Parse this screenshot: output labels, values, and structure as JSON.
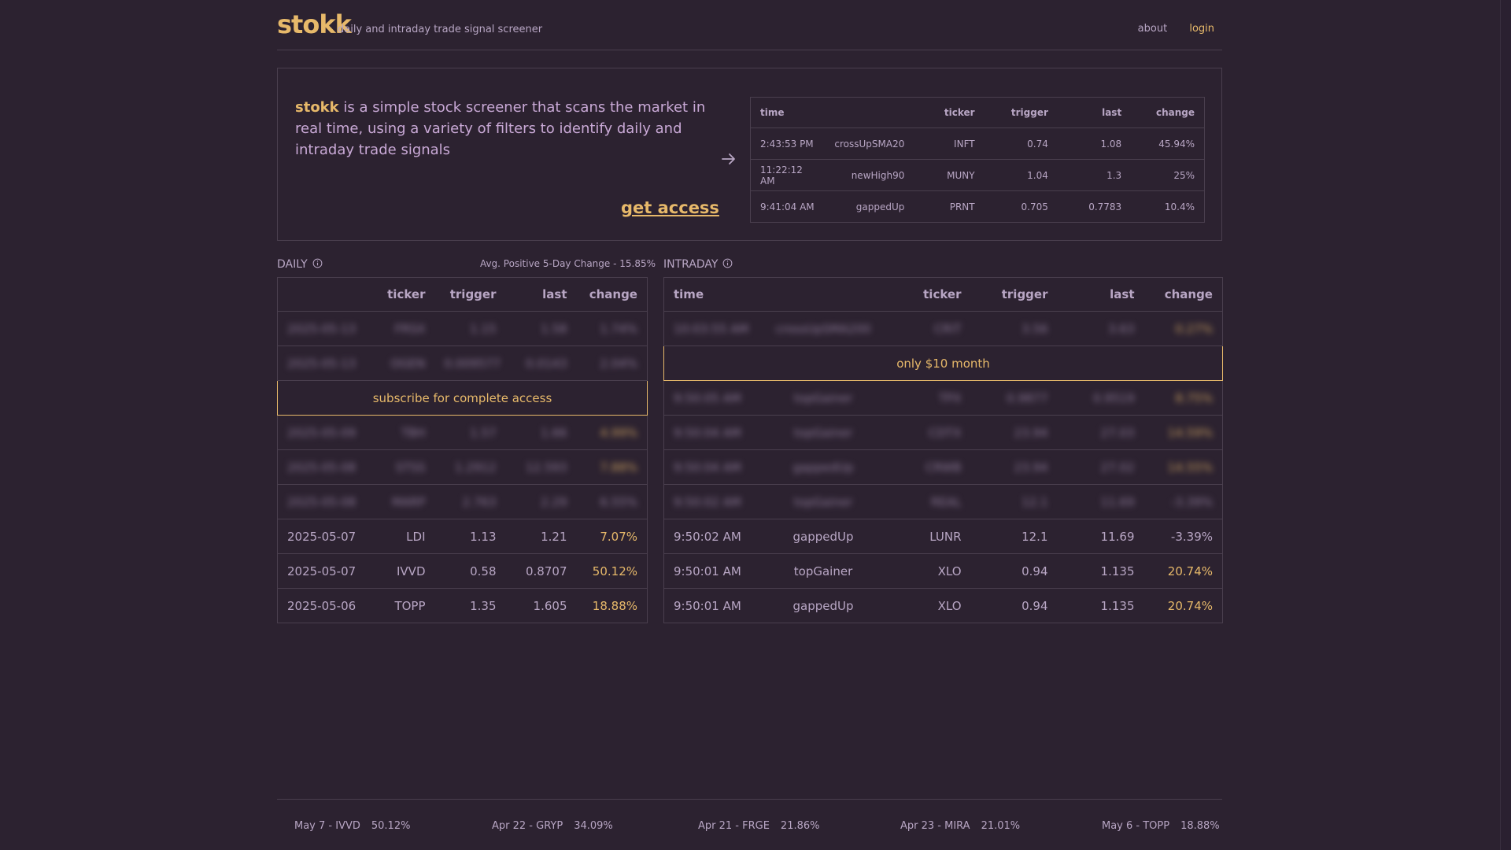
{
  "header": {
    "logo": "stokk",
    "tagline": "daily and intraday trade signal screener",
    "nav": {
      "about": "about",
      "login": "login"
    }
  },
  "hero": {
    "brand": "stokk",
    "description": " is a simple stock screener that scans the market in real time, using a variety of filters to identify daily and intraday trade signals",
    "cta": "get access",
    "table": {
      "headers": {
        "time": "time",
        "ticker": "ticker",
        "trigger": "trigger",
        "last": "last",
        "change": "change"
      },
      "rows": [
        {
          "time": "2:43:53 PM",
          "signal": "crossUpSMA20",
          "ticker": "INFT",
          "trigger": "0.74",
          "last": "1.08",
          "change": "45.94%"
        },
        {
          "time": "11:22:12 AM",
          "signal": "newHigh90",
          "ticker": "MUNY",
          "trigger": "1.04",
          "last": "1.3",
          "change": "25%"
        },
        {
          "time": "9:41:04 AM",
          "signal": "gappedUp",
          "ticker": "PRNT",
          "trigger": "0.705",
          "last": "0.7783",
          "change": "10.4%"
        }
      ]
    }
  },
  "daily": {
    "title": "DAILY",
    "avg_label": "Avg. Positive 5-Day Change - 15.85%",
    "headers": {
      "ticker": "ticker",
      "trigger": "trigger",
      "last": "last",
      "change": "change"
    },
    "blurred_rows": [
      {
        "date": "2025-05-13",
        "ticker": "FRSX",
        "trigger": "1.15",
        "last": "1.58",
        "change": "1.74%"
      },
      {
        "date": "2025-05-13",
        "ticker": "OGEN",
        "trigger": "0.009577",
        "last": "0.0143",
        "change": "2.04%"
      },
      {
        "date": "2025-05-09",
        "ticker": "TBH",
        "trigger": "1.57",
        "last": "1.66",
        "change": "4.99%"
      },
      {
        "date": "2025-05-08",
        "ticker": "STSS",
        "trigger": "1.2912",
        "last": "12.593",
        "change": "7.88%"
      },
      {
        "date": "2025-05-08",
        "ticker": "MARP",
        "trigger": "2.763",
        "last": "2.29",
        "change": "6.55%"
      }
    ],
    "promo": "subscribe for complete access",
    "rows": [
      {
        "date": "2025-05-07",
        "ticker": "LDI",
        "trigger": "1.13",
        "last": "1.21",
        "change": "7.07%"
      },
      {
        "date": "2025-05-07",
        "ticker": "IVVD",
        "trigger": "0.58",
        "last": "0.8707",
        "change": "50.12%"
      },
      {
        "date": "2025-05-06",
        "ticker": "TOPP",
        "trigger": "1.35",
        "last": "1.605",
        "change": "18.88%"
      }
    ]
  },
  "intraday": {
    "title": "INTRADAY",
    "headers": {
      "time": "time",
      "ticker": "ticker",
      "trigger": "trigger",
      "last": "last",
      "change": "change"
    },
    "blurred_rows": [
      {
        "time": "10:03:55 AM",
        "signal": "crossUpSMA200",
        "ticker": "CRIT",
        "trigger": "3.56",
        "last": "3.63",
        "change": "0.27%"
      },
      {
        "time": "9:50:05 AM",
        "signal": "topGainer",
        "ticker": "TPX",
        "trigger": "0.9877",
        "last": "0.9519",
        "change": "8.75%"
      },
      {
        "time": "9:50:04 AM",
        "signal": "topGainer",
        "ticker": "CDTX",
        "trigger": "23.94",
        "last": "27.03",
        "change": "14.59%"
      },
      {
        "time": "9:50:04 AM",
        "signal": "gappedUp",
        "ticker": "CRWB",
        "trigger": "23.94",
        "last": "27.02",
        "change": "14.55%"
      },
      {
        "time": "9:50:02 AM",
        "signal": "topGainer",
        "ticker": "REAL",
        "trigger": "12.1",
        "last": "11.69",
        "change": "-3.39%"
      }
    ],
    "promo": "only $10 month",
    "rows": [
      {
        "time": "9:50:02 AM",
        "signal": "gappedUp",
        "ticker": "LUNR",
        "trigger": "12.1",
        "last": "11.69",
        "change": "-3.39%"
      },
      {
        "time": "9:50:01 AM",
        "signal": "topGainer",
        "ticker": "XLO",
        "trigger": "0.94",
        "last": "1.135",
        "change": "20.74%"
      },
      {
        "time": "9:50:01 AM",
        "signal": "gappedUp",
        "ticker": "XLO",
        "trigger": "0.94",
        "last": "1.135",
        "change": "20.74%"
      }
    ]
  },
  "footer_ticker": [
    {
      "label": "May 7 - IVVD",
      "pct": "50.12%"
    },
    {
      "label": "Apr 22 - GRYP",
      "pct": "34.09%"
    },
    {
      "label": "Apr 21 - FRGE",
      "pct": "21.86%"
    },
    {
      "label": "Apr 23 - MIRA",
      "pct": "21.01%"
    },
    {
      "label": "May 6 - TOPP",
      "pct": "18.88%"
    }
  ],
  "colors": {
    "background": "#2c2230",
    "accent": "#e7b96a",
    "text": "#b8a6c4",
    "border": "#4a3f4e"
  }
}
